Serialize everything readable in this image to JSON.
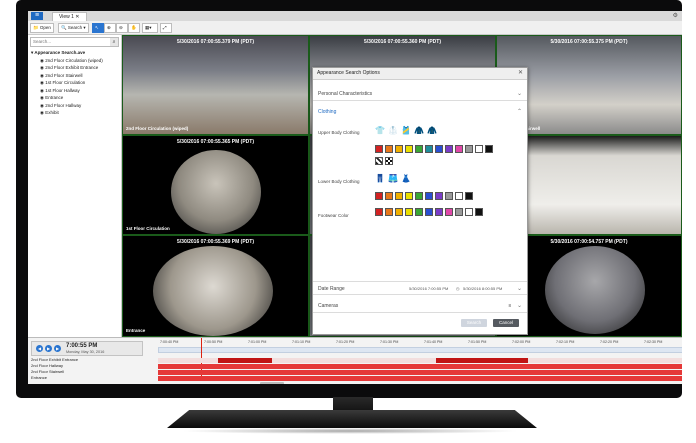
{
  "colors": {
    "accent": "#1f6ac2",
    "track_red": "#e53838",
    "dark_red": "#c01414"
  },
  "titlebar": {
    "menu_icon": "hamburger-icon",
    "tab_label": "View 1",
    "settings_icon": "gear-icon"
  },
  "toolbar": {
    "open_label": "Open",
    "search_label": "Search",
    "icons": [
      "pointer-icon",
      "zoom-in-icon",
      "zoom-out-icon",
      "pan-icon",
      "layout-icon",
      "fullscreen-icon"
    ]
  },
  "sidebar": {
    "search_placeholder": "Search...",
    "items": [
      {
        "label": "Appearance Search.ave",
        "root": true
      },
      {
        "label": "2nd Floor Circulation (wiped)"
      },
      {
        "label": "2nd Floor Exhibit Entrance"
      },
      {
        "label": "2nd Floor Stairwell"
      },
      {
        "label": "1st Floor Circulation"
      },
      {
        "label": "1st Floor Hallway"
      },
      {
        "label": "Entrance"
      },
      {
        "label": "2nd Floor Hallway"
      },
      {
        "label": "Exhibit"
      }
    ]
  },
  "cameras": [
    {
      "timestamp": "5/30/2016 07:00:55.379 PM (PDT)",
      "label": "2nd Floor Circulation (wiped)"
    },
    {
      "timestamp": "5/30/2016 07:00:55.360 PM (PDT)",
      "label": ""
    },
    {
      "timestamp": "5/30/2016 07:00:55.375 PM (PDT)",
      "label": "2nd Floor Stairwell"
    },
    {
      "timestamp": "5/30/2016 07:00:55.365 PM (PDT)",
      "label": "1st Floor Circulation"
    },
    {
      "timestamp": "",
      "label": ""
    },
    {
      "timestamp": "",
      "label": ""
    },
    {
      "timestamp": "5/30/2016 07:00:55.369 PM (PDT)",
      "label": "Entrance"
    },
    {
      "timestamp": "",
      "label": ""
    },
    {
      "timestamp": "5/30/2016 07:00:54.757 PM (PDT)",
      "label": "Exhibit"
    }
  ],
  "dialog": {
    "title": "Appearance Search Options",
    "personal": "Personal Characteristics",
    "clothing": "Clothing",
    "upper_label": "Upper Body Clothing",
    "lower_label": "Lower Body Clothing",
    "footwear_label": "Footwear Color",
    "date_range_label": "Date Range",
    "date_range_value": "5/30/2016 7:00:55 PM",
    "date_range_end": "5/30/2016 8:00:55 PM",
    "cameras_label": "Cameras",
    "cameras_count": "8",
    "search_button": "Search",
    "cancel_button": "Cancel",
    "palette_upper": [
      "#d32222",
      "#e7781b",
      "#f0b000",
      "#eadf00",
      "#3aa635",
      "#1f8d9b",
      "#2a4fd2",
      "#7a3cc8",
      "#e048a8",
      "#9a9a9a",
      "#ffffff",
      "#111111"
    ],
    "palette_lower": [
      "#d32222",
      "#e7781b",
      "#f0b000",
      "#eadf00",
      "#3aa635",
      "#2a4fd2",
      "#7a3cc8",
      "#9a9a9a",
      "#ffffff",
      "#111111"
    ],
    "palette_footwear": [
      "#d32222",
      "#e7781b",
      "#f0b000",
      "#eadf00",
      "#3aa635",
      "#2a4fd2",
      "#7a3cc8",
      "#e048a8",
      "#9a9a9a",
      "#ffffff",
      "#111111"
    ]
  },
  "timeline": {
    "clock_time": "7:00:55 PM",
    "clock_date": "Monday, May 30, 2016",
    "tracks": [
      "2nd Floor Exhibit Entrance",
      "2nd Floor Hallway",
      "2nd Floor Stairwell",
      "Entrance"
    ],
    "ticks": [
      "7:00:40 PM",
      "7:00:50 PM",
      "7:01:00 PM",
      "7:01:10 PM",
      "7:01:20 PM",
      "7:01:30 PM",
      "7:01:40 PM",
      "7:01:50 PM",
      "7:02:00 PM",
      "7:02:10 PM",
      "7:02:20 PM",
      "7:02:30 PM"
    ]
  }
}
